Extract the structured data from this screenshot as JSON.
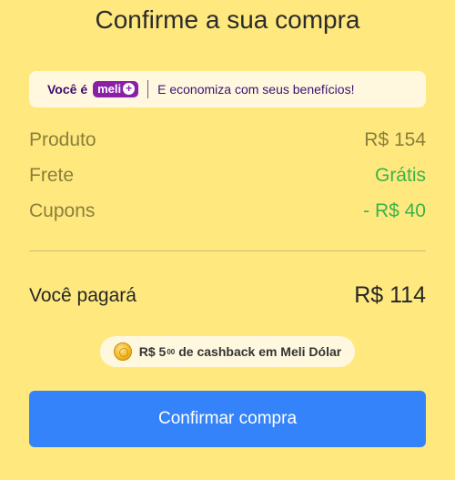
{
  "header": {
    "title": "Confirme a sua compra"
  },
  "meli_banner": {
    "prefix": "Você é",
    "badge_text": "meli",
    "badge_plus": "+",
    "benefit": "E economiza com seus benefícios!"
  },
  "summary": {
    "rows": [
      {
        "label": "Produto",
        "value": "R$ 154"
      },
      {
        "label": "Frete",
        "value": "Grátis"
      },
      {
        "label": "Cupons",
        "value": "- R$ 40"
      }
    ],
    "total_label": "Você pagará",
    "total_value": "R$ 114"
  },
  "cashback": {
    "currency": "R$ 5",
    "cents": "00",
    "text": "de cashback em Meli Dólar",
    "icon": "coin-icon"
  },
  "actions": {
    "confirm_label": "Confirmar compra"
  },
  "colors": {
    "background": "#ffe97f",
    "accent_blue": "#3483fa",
    "green": "#3bb34b",
    "meli_purple": "#8a1fa8"
  }
}
